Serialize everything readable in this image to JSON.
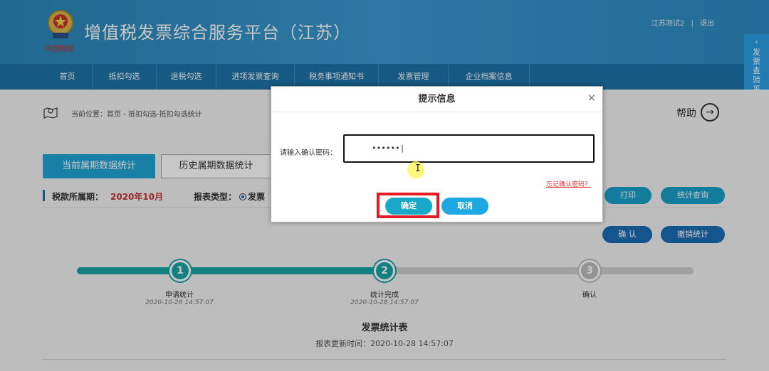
{
  "header": {
    "title": "增值税发票综合服务平台（江苏）",
    "emblem_caption": "中国税务",
    "user": "江苏测试2",
    "separator": "|",
    "logout": "退出"
  },
  "nav": {
    "items": [
      "首页",
      "抵扣勾选",
      "退税勾选",
      "进项发票查询",
      "税务事项通知书",
      "发票管理",
      "企业档案信息"
    ]
  },
  "side_tab": {
    "label": "发票查验平台"
  },
  "breadcrumb": "当前位置：首页 - 抵扣勾选-抵扣勾选统计",
  "help": {
    "label": "帮助",
    "icon": "arrow-right-circle-icon"
  },
  "tabs": {
    "current": "当前属期数据统计",
    "history": "历史属期数据统计"
  },
  "period": {
    "label": "税款所属期：",
    "value": "2020年10月"
  },
  "report_type": {
    "label": "报表类型：",
    "selected": "发票"
  },
  "actions": {
    "print": "打印",
    "stat_query": "统计查询",
    "confirm": "确 认",
    "revoke": "撤销统计"
  },
  "steps": [
    {
      "num": "1",
      "label": "申请统计",
      "time": "2020-10-28 14:57:07"
    },
    {
      "num": "2",
      "label": "统计完成",
      "time": "2020-10-28 14:57:07"
    },
    {
      "num": "3",
      "label": "确认",
      "time": ""
    }
  ],
  "progress": {
    "completed_steps": 2,
    "total_steps": 3
  },
  "table": {
    "title": "发票统计表",
    "update_time": "报表更新时间：2020-10-28 14:57:07"
  },
  "dialog": {
    "title": "提示信息",
    "close": "×",
    "password_label": "请输入确认密码：",
    "password_value": "••••••|",
    "forget_link": "忘记确认密码？",
    "ok": "确定",
    "cancel": "取消"
  },
  "colors": {
    "header_blue": "#2a86b8",
    "nav_blue": "#1d72a8",
    "accent_teal": "#18a3a6",
    "highlight_red": "#e51c23",
    "period_red": "#c23531"
  }
}
